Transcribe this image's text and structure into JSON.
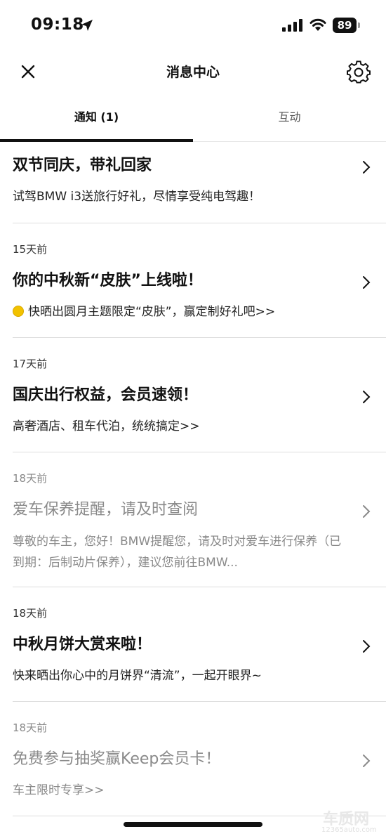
{
  "status_bar": {
    "time": "09:18",
    "battery": "89"
  },
  "nav": {
    "title": "消息中心"
  },
  "tabs": [
    {
      "label": "通知 (1)",
      "active": true
    },
    {
      "label": "互动",
      "active": false
    }
  ],
  "messages": [
    {
      "time": "",
      "title": "双节同庆，带礼回家",
      "desc": "试驾BMW i3送旅行好礼，尽情享受纯电驾趣！",
      "read": false
    },
    {
      "time": "15天前",
      "title": "你的中秋新“皮肤”上线啦！",
      "desc": "快晒出圆月主题限定“皮肤”，赢定制好礼吧>>",
      "read": false
    },
    {
      "time": "17天前",
      "title": "国庆出行权益，会员速领！",
      "desc": "高奢酒店、租车代泊，统统搞定>>",
      "read": false
    },
    {
      "time": "18天前",
      "title": "爱车保养提醒，请及时查阅",
      "desc": "尊敬的车主，您好！BMW提醒您，请及时对爱车进行保养（已到期：后制动片保养），建议您前往BMW...",
      "read": true
    },
    {
      "time": "18天前",
      "title": "中秋月饼大赏来啦！",
      "desc": "快来晒出你心中的月饼界“清流”，一起开眼界~",
      "read": false
    },
    {
      "time": "18天前",
      "title": "免费参与抽奖赢Keep会员卡！",
      "desc": "车主限时专享>>",
      "read": true
    }
  ],
  "watermark": {
    "brand": "车质网",
    "url": "12365auto.com"
  },
  "icons": {
    "close": "close-icon",
    "settings": "gear-icon",
    "chevron": "chevron-right-icon",
    "location": "location-arrow-icon",
    "coin": "gold-coin-icon"
  },
  "colors": {
    "unread_title": "#111111",
    "read_title": "#8a8a8a",
    "divider": "#dddddd"
  }
}
